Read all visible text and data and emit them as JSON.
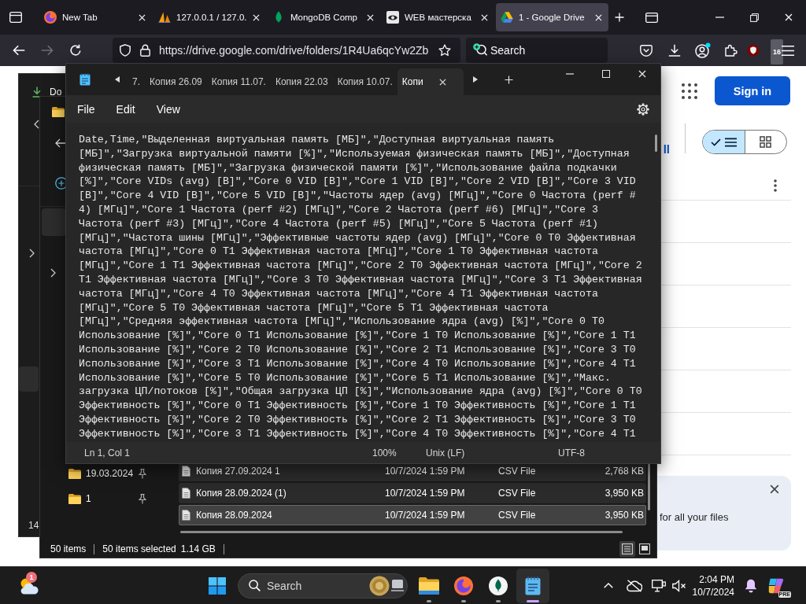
{
  "browser": {
    "tabs": [
      {
        "title": "New Tab",
        "kind": "fox",
        "selected": false
      },
      {
        "title": "127.0.0.1 / 127.0.",
        "kind": "sails",
        "selected": false
      },
      {
        "title": "MongoDB Comp",
        "kind": "leaf",
        "selected": false
      },
      {
        "title": "WEB мастерска",
        "kind": "eye",
        "selected": false
      },
      {
        "title": "1 - Google Drive",
        "kind": "triangle",
        "selected": true
      }
    ],
    "nav_buttons": [
      {
        "kind": "back",
        "disabled": false
      },
      {
        "kind": "forward",
        "disabled": true
      },
      {
        "kind": "reload",
        "disabled": false
      }
    ],
    "address": "https://drive.google.com/drive/folders/1R4Ua6qcYw2Zb",
    "search": {
      "placeholder": "Search"
    },
    "addon_badge": "16"
  },
  "drive_page": {
    "sign_in": "Sign in",
    "cut_label": "ll",
    "view_toggle": [
      {
        "kind": "list",
        "selected": true
      },
      {
        "kind": "grid",
        "selected": false
      }
    ],
    "notice": {
      "text": "for all your files"
    }
  },
  "explorer_back": {
    "nav_label": "Do",
    "status": "14"
  },
  "explorer": {
    "nav_items": [
      {
        "label": "19.03.2024",
        "pinned": true
      },
      {
        "label": "1",
        "pinned": true
      }
    ],
    "files": [
      {
        "name": "Копия 27.09.2024 1",
        "modified": "10/7/2024 1:59 PM",
        "type": "CSV File",
        "size": "2,768 KB",
        "selected": true,
        "focused": false
      },
      {
        "name": "Копия 28.09.2024 (1)",
        "modified": "10/7/2024 1:59 PM",
        "type": "CSV File",
        "size": "3,950 KB",
        "selected": true,
        "focused": false
      },
      {
        "name": "Копия 28.09.2024",
        "modified": "10/7/2024 1:59 PM",
        "type": "CSV File",
        "size": "3,950 KB",
        "selected": true,
        "focused": true
      }
    ],
    "status": {
      "count": "50 items",
      "selection": "50 items selected",
      "size": "1.14 GB"
    },
    "view_buttons": [
      {
        "kind": "details",
        "selected": true
      },
      {
        "kind": "tiles",
        "selected": false
      }
    ]
  },
  "notepad": {
    "tabs": [
      {
        "title": "7.",
        "selected": false
      },
      {
        "title": "Копия 26.09",
        "selected": false
      },
      {
        "title": "Копия 11.07.",
        "selected": false
      },
      {
        "title": "Копия 22.03",
        "selected": false
      },
      {
        "title": "Копия 10.07.",
        "selected": false
      },
      {
        "title": "Копи",
        "selected": true
      }
    ],
    "menu": [
      "File",
      "Edit",
      "View"
    ],
    "lines": [
      "Date,Time,\"Выделенная виртуальная память [МБ]\",\"Доступная виртуальная память",
      "[МБ]\",\"Загрузка виртуальной памяти [%]\",\"Используемая физическая память [МБ]\",\"Доступная",
      "физическая память [МБ]\",\"Загрузка физической памяти [%]\",\"Использование файла подкачки",
      "[%]\",\"Core VIDs (avg) [В]\",\"Core 0 VID [В]\",\"Core 1 VID [В]\",\"Core 2 VID [В]\",\"Core 3 VID",
      "[В]\",\"Core 4 VID [В]\",\"Core 5 VID [В]\",\"Частоты ядер (avg) [МГц]\",\"Core 0 Частота (perf #",
      "4) [МГц]\",\"Core 1 Частота (perf #2) [МГц]\",\"Core 2 Частота (perf #6) [МГц]\",\"Core 3",
      "Частота (perf #3) [МГц]\",\"Core 4 Частота (perf #5) [МГц]\",\"Core 5 Частота (perf #1)",
      "[МГц]\",\"Частота шины [МГц]\",\"Эффективные частоты ядер (avg) [МГц]\",\"Core 0 T0 Эффективная",
      "частота [МГц]\",\"Core 0 T1 Эффективная частота [МГц]\",\"Core 1 T0 Эффективная частота",
      "[МГц]\",\"Core 1 T1 Эффективная частота [МГц]\",\"Core 2 T0 Эффективная частота [МГц]\",\"Core 2",
      "T1 Эффективная частота [МГц]\",\"Core 3 T0 Эффективная частота [МГц]\",\"Core 3 T1 Эффективная",
      "частота [МГц]\",\"Core 4 T0 Эффективная частота [МГц]\",\"Core 4 T1 Эффективная частота",
      "[МГц]\",\"Core 5 T0 Эффективная частота [МГц]\",\"Core 5 T1 Эффективная частота",
      "[МГц]\",\"Средняя эффективная частота [МГц]\",\"Использование ядра (avg) [%]\",\"Core 0 T0",
      "Использование [%]\",\"Core 0 T1 Использование [%]\",\"Core 1 T0 Использование [%]\",\"Core 1 T1",
      "Использование [%]\",\"Core 2 T0 Использование [%]\",\"Core 2 T1 Использование [%]\",\"Core 3 T0",
      "Использование [%]\",\"Core 3 T1 Использование [%]\",\"Core 4 T0 Использование [%]\",\"Core 4 T1",
      "Использование [%]\",\"Core 5 T0 Использование [%]\",\"Core 5 T1 Использование [%]\",\"Макс.",
      "загрузка ЦП/потоков [%]\",\"Общая загрузка ЦП [%]\",\"Использование ядра (avg) [%]\",\"Core 0 T0",
      "Эффективность [%]\",\"Core 0 T1 Эффективность [%]\",\"Core 1 T0 Эффективность [%]\",\"Core 1 T1",
      "Эффективность [%]\",\"Core 2 T0 Эффективность [%]\",\"Core 2 T1 Эффективность [%]\",\"Core 3 T0",
      "Эффективность [%]\",\"Core 3 T1 Эффективность [%]\",\"Core 4 T0 Эффективность [%]\",\"Core 4 T1"
    ],
    "status": {
      "position": "Ln 1, Col 1",
      "zoom": "100%",
      "line_ending": "Unix (LF)",
      "encoding": "UTF-8"
    }
  },
  "taskbar": {
    "weather_badge": "1",
    "search": {
      "placeholder": "Search"
    },
    "apps": [
      {
        "kind": "folder",
        "running": true,
        "active": false
      },
      {
        "kind": "fox",
        "running": true,
        "active": false
      },
      {
        "kind": "leaf",
        "running": true,
        "active": false
      },
      {
        "kind": "notepad",
        "running": true,
        "active": true
      }
    ],
    "clock": {
      "time": "2:04 PM",
      "date": "10/7/2024"
    },
    "preview_tag": "PRE"
  }
}
